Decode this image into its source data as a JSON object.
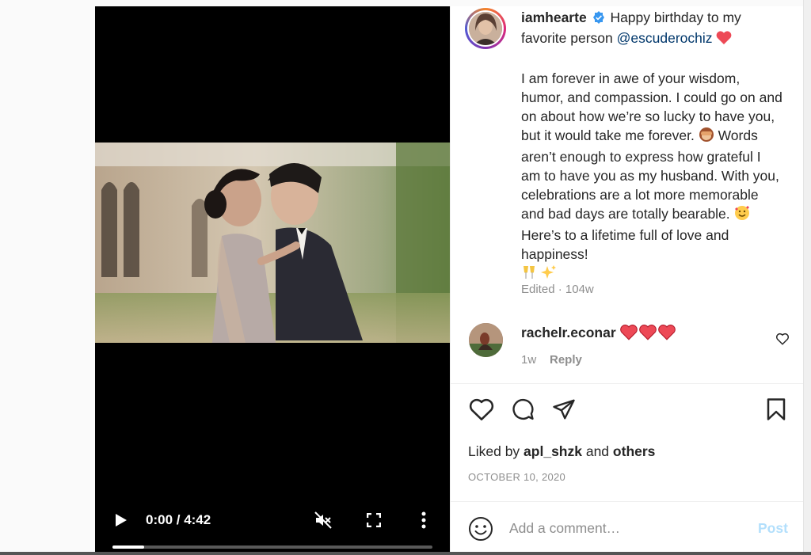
{
  "post": {
    "username": "iamhearte",
    "caption_line1": "Happy birthday to my favorite person ",
    "mention": "@escuderochiz",
    "caption_body_1": "I am forever in awe of your wisdom, humor, and compassion. I could go on and on about how we’re so lucky to have you, but it would take me forever. ",
    "caption_body_2": " Words aren’t enough to express how grateful I am to have you as my husband. With you, celebrations are a lot more memorable and bad days are totally bearable. ",
    "caption_body_3": " Here’s to a lifetime full of love and happiness!",
    "edited": "Edited",
    "meta_sep": " · ",
    "age": "104w"
  },
  "video": {
    "time": "0:00 / 4:42",
    "progress": 0.1
  },
  "comment": {
    "username": "rachelr.econar",
    "time": "1w",
    "reply_label": "Reply"
  },
  "likes": {
    "prefix": "Liked by ",
    "user": "apl_shzk",
    "and": " and ",
    "others": "others"
  },
  "date": "OCTOBER 10, 2020",
  "add_comment": {
    "placeholder": "Add a comment…",
    "post_label": "Post"
  },
  "icons": {
    "verified": "verified-badge-icon",
    "like": "heart-icon",
    "comment": "comment-icon",
    "share": "paper-plane-icon",
    "save": "bookmark-icon",
    "emoji": "smiley-icon",
    "play": "play-icon",
    "mute": "mute-icon",
    "fullscreen": "fullscreen-icon",
    "more": "more-vertical-icon"
  },
  "colors": {
    "mention": "#00376b",
    "heart_red": "#ed4956",
    "verified_blue": "#3897f0",
    "post_disabled": "#b2dffc",
    "muted_text": "#8e8e8e"
  }
}
